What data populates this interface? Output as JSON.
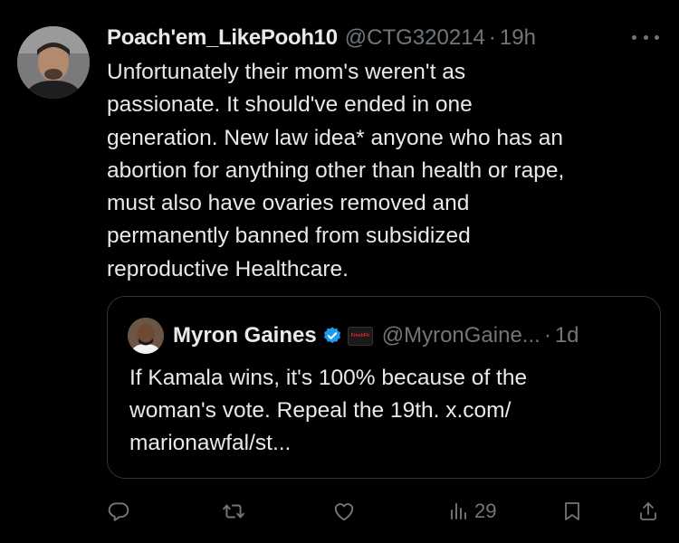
{
  "tweet": {
    "display_name": "Poach'em_LikePooh10",
    "handle": "@CTG320214",
    "separator": "·",
    "time": "19h",
    "text": "Unfortunately their mom's weren't as\npassionate. It should've ended in one\ngeneration. New law idea* anyone who has an\nabortion for anything other than health or rape,\nmust also have ovaries removed and\npermanently banned from subsidized\nreproductive Healthcare."
  },
  "quote": {
    "display_name": "Myron Gaines",
    "affiliate_badge_text": "FreshFit",
    "handle": "@MyronGaine...",
    "separator": "·",
    "time": "1d",
    "text": "If Kamala wins, it's 100% because of the\nwoman's vote. Repeal the 19th. x.com/\nmarionawfal/st..."
  },
  "actions": {
    "reply_count": "",
    "retweet_count": "",
    "like_count": "",
    "views_count": "29"
  },
  "colors": {
    "background": "#000000",
    "text_primary": "#e7e9ea",
    "text_secondary": "#71767b",
    "border": "#2f3336",
    "verified_blue": "#1d9bf0",
    "affiliate_red": "#e0242a"
  },
  "icons": {
    "more": "more-horizontal-icon",
    "verified": "verified-badge-icon",
    "reply": "reply-icon",
    "retweet": "retweet-icon",
    "like": "heart-icon",
    "views": "views-chart-icon",
    "bookmark": "bookmark-icon",
    "share": "share-icon"
  }
}
